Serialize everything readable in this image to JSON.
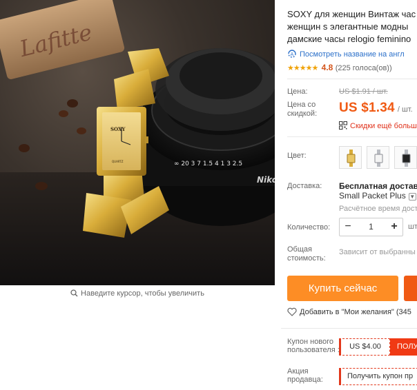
{
  "product": {
    "title_lines": [
      "SOXY для женщин Винтаж час",
      "женщин s элегантные модны",
      "дамские часы relogio feminino"
    ],
    "image_alt": "SOXY gold women watch",
    "watch_brand": "SOXY",
    "watch_label": "QUARTZ",
    "cork_text": "Lafitte",
    "lens_brand": "Nikon"
  },
  "zoom_hint": "Наведите курсор, чтобы увеличить",
  "translate_link": "Посмотреть название на англ",
  "rating": {
    "stars": "★★★★★",
    "value": "4.8",
    "count": "(225 голоса(ов))"
  },
  "price": {
    "label": "Цена:",
    "old": "US $1.91 / шт.",
    "discount_label": "Цена со скидкой:",
    "new_amount": "US $1.34",
    "new_unit": "/ шт.",
    "extra_discount": "Скидки ещё больш"
  },
  "color": {
    "label": "Цвет:",
    "options": [
      "gold",
      "silver-white",
      "silver-black"
    ]
  },
  "shipping": {
    "label": "Доставка:",
    "method": "Бесплатная доставка",
    "carrier": "Small Packet Plus",
    "estimate": "Расчётное время дост"
  },
  "quantity": {
    "label": "Количество:",
    "value": "1",
    "minus": "−",
    "plus": "+",
    "unit": "шт"
  },
  "total": {
    "label": "Общая стоимость:",
    "value": "Зависит от выбранны"
  },
  "actions": {
    "buy_now": "Купить сейчас",
    "wishlist": "Добавить в \"Мои желания\" (345"
  },
  "coupons": {
    "new_user_label": "Купон нового пользователя :",
    "new_user_amount": "US $4.00",
    "new_user_button": "ПОЛУ",
    "seller_label": "Акция продавца:",
    "seller_button": "Получить купон пр"
  },
  "colors": {
    "accent_orange": "#fd8d25",
    "price_orange": "#f05a14",
    "coupon_red": "#e2381b",
    "link_blue": "#2a6fc9",
    "star_yellow": "#f0a30a"
  }
}
